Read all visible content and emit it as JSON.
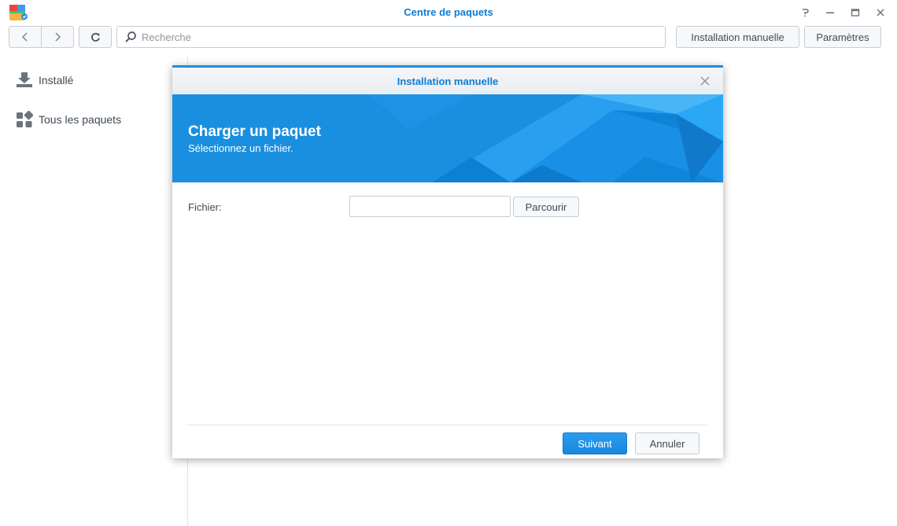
{
  "window": {
    "title": "Centre de paquets",
    "app_icon": "package-center-icon",
    "controls": [
      "help-icon",
      "minimize-icon",
      "maximize-icon",
      "close-icon"
    ]
  },
  "toolbar": {
    "back_icon": "chevron-left-icon",
    "forward_icon": "chevron-right-icon",
    "refresh_icon": "refresh-icon",
    "search": {
      "placeholder": "Recherche",
      "value": "",
      "icon": "search-icon"
    },
    "manual_install_label": "Installation manuelle",
    "settings_label": "Paramètres"
  },
  "sidebar": {
    "items": [
      {
        "label": "Installé",
        "icon": "download-icon"
      },
      {
        "label": "Tous les paquets",
        "icon": "grid-icon"
      }
    ]
  },
  "dialog": {
    "title": "Installation manuelle",
    "banner_title": "Charger un paquet",
    "banner_subtitle": "Sélectionnez un fichier.",
    "file_label": "Fichier:",
    "file_value": "",
    "browse_label": "Parcourir",
    "next_label": "Suivant",
    "cancel_label": "Annuler"
  },
  "colors": {
    "accent": "#0f7bd1",
    "banner_blue": "#1a8fe0",
    "primary_button": "#1888e0",
    "border": "#c6cdd5"
  }
}
